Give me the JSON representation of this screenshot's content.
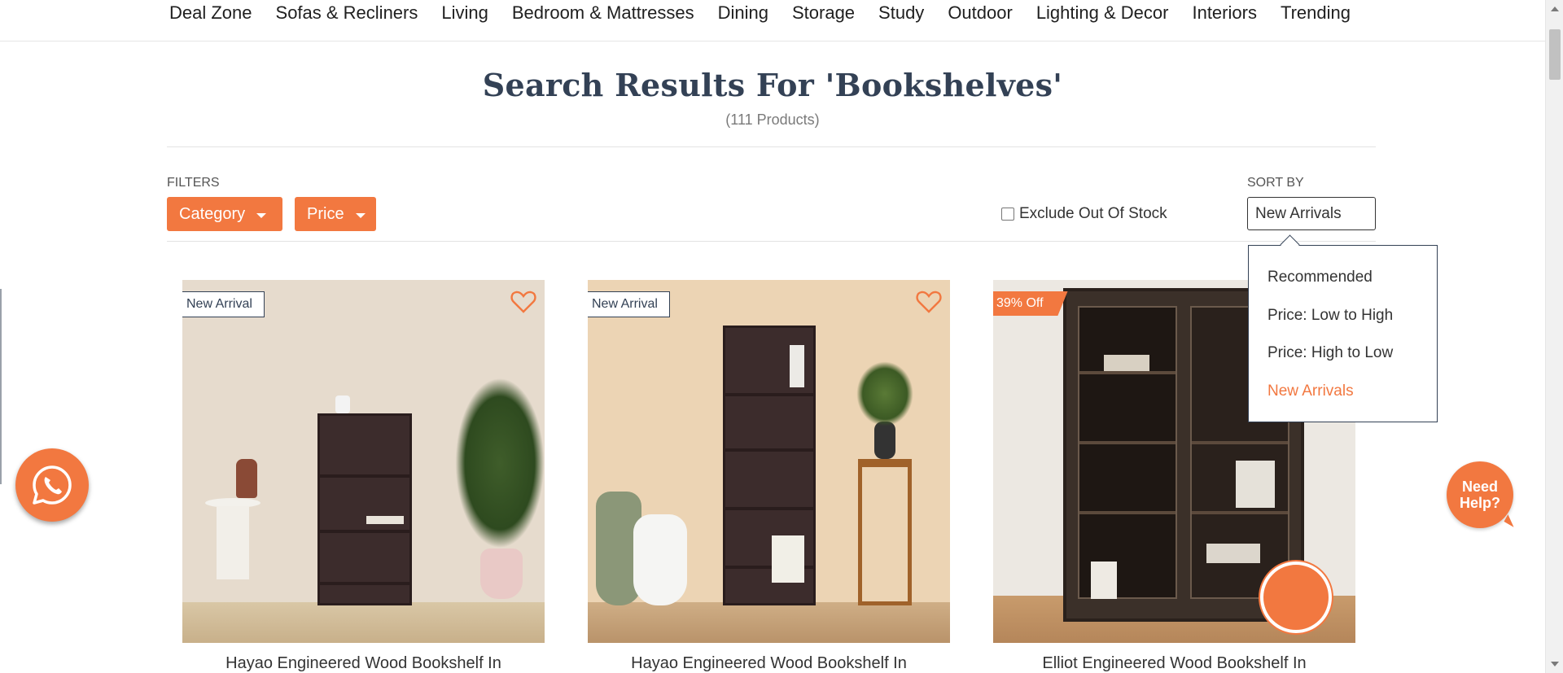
{
  "nav": {
    "items": [
      {
        "label": "Deal Zone"
      },
      {
        "label": "Sofas & Recliners"
      },
      {
        "label": "Living"
      },
      {
        "label": "Bedroom & Mattresses"
      },
      {
        "label": "Dining"
      },
      {
        "label": "Storage"
      },
      {
        "label": "Study"
      },
      {
        "label": "Outdoor"
      },
      {
        "label": "Lighting & Decor"
      },
      {
        "label": "Interiors"
      },
      {
        "label": "Trending"
      }
    ]
  },
  "header": {
    "title": "Search Results For 'Bookshelves'",
    "count": "(111 Products)"
  },
  "filters": {
    "label": "FILTERS",
    "category_label": "Category",
    "price_label": "Price",
    "exclude_label": "Exclude Out Of Stock",
    "exclude_checked": false
  },
  "sort": {
    "label": "SORT BY",
    "selected": "New Arrivals",
    "options": [
      "Recommended",
      "Price: Low to High",
      "Price: High to Low",
      "New Arrivals"
    ]
  },
  "products": [
    {
      "badge": "New Arrival",
      "title": "Hayao Engineered Wood Bookshelf In"
    },
    {
      "badge": "New Arrival",
      "title": "Hayao Engineered Wood Bookshelf In"
    },
    {
      "badge": "39% Off",
      "title": "Elliot Engineered Wood Bookshelf In"
    }
  ],
  "floating": {
    "help_label": "Need Help?"
  },
  "colors": {
    "accent": "#f27840",
    "heading": "#334155"
  }
}
